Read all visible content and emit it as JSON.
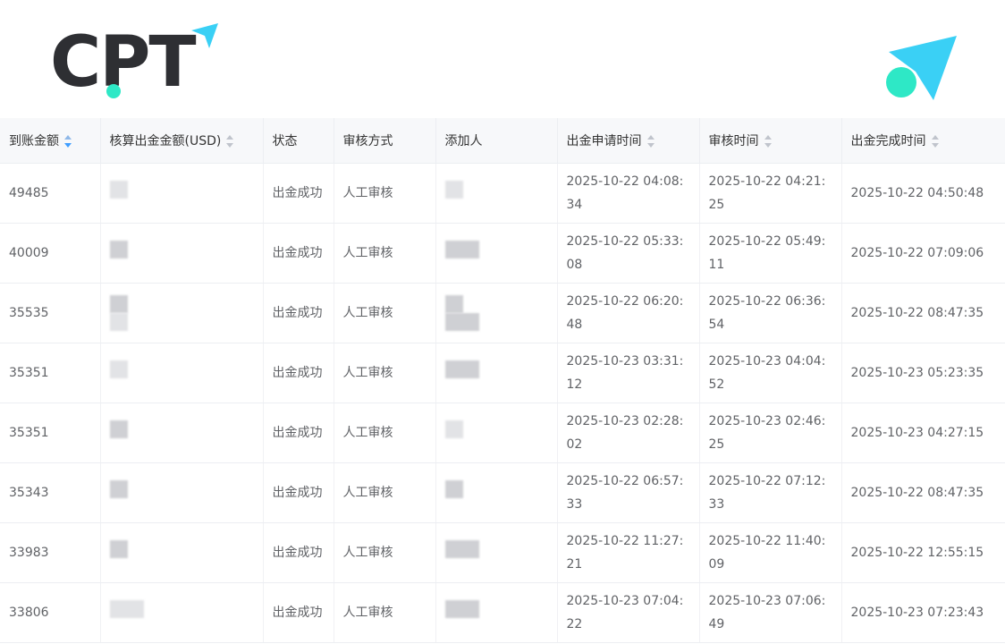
{
  "brand": {
    "logo_text": "CPT",
    "accent": "#2ee8c6",
    "arrow_color": "#3ad0f5"
  },
  "table": {
    "columns": [
      "到账金额",
      "核算出金金额(USD)",
      "状态",
      "审核方式",
      "添加人",
      "出金申请时间",
      "审核时间",
      "出金完成时间"
    ],
    "rows": [
      {
        "amount": "49485",
        "status": "出金成功",
        "method": "人工审核",
        "apply": "2025-10-22 04:08:34",
        "review": "2025-10-22 04:21:25",
        "done": "2025-10-22 04:50:48"
      },
      {
        "amount": "40009",
        "status": "出金成功",
        "method": "人工审核",
        "apply": "2025-10-22 05:33:08",
        "review": "2025-10-22 05:49:11",
        "done": "2025-10-22 07:09:06"
      },
      {
        "amount": "35535",
        "status": "出金成功",
        "method": "人工审核",
        "apply": "2025-10-22 06:20:48",
        "review": "2025-10-22 06:36:54",
        "done": "2025-10-22 08:47:35"
      },
      {
        "amount": "35351",
        "status": "出金成功",
        "method": "人工审核",
        "apply": "2025-10-23 03:31:12",
        "review": "2025-10-23 04:04:52",
        "done": "2025-10-23 05:23:35"
      },
      {
        "amount": "35351",
        "status": "出金成功",
        "method": "人工审核",
        "apply": "2025-10-23 02:28:02",
        "review": "2025-10-23 02:46:25",
        "done": "2025-10-23 04:27:15"
      },
      {
        "amount": "35343",
        "status": "出金成功",
        "method": "人工审核",
        "apply": "2025-10-22 06:57:33",
        "review": "2025-10-22 07:12:33",
        "done": "2025-10-22 08:47:35"
      },
      {
        "amount": "33983",
        "status": "出金成功",
        "method": "人工审核",
        "apply": "2025-10-22 11:27:21",
        "review": "2025-10-22 11:40:09",
        "done": "2025-10-22 12:55:15"
      },
      {
        "amount": "33806",
        "status": "出金成功",
        "method": "人工审核",
        "apply": "2025-10-23 07:04:22",
        "review": "2025-10-23 07:06:49",
        "done": "2025-10-23 07:23:43"
      }
    ]
  }
}
